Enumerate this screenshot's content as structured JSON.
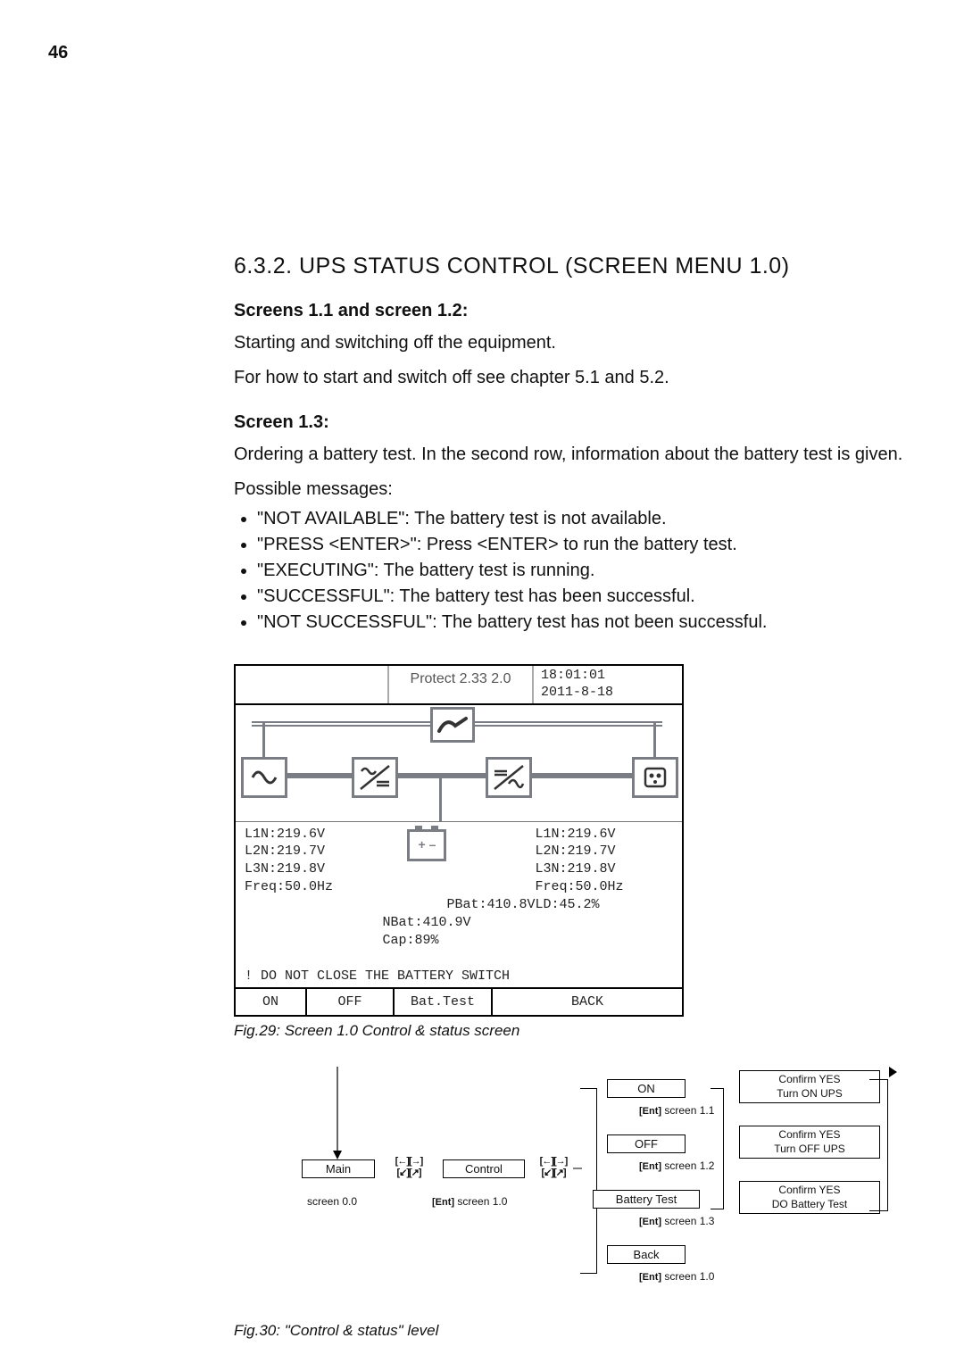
{
  "page_number": "46",
  "section_title": "6.3.2. UPS STATUS CONTROL (SCREEN MENU 1.0)",
  "subhead1": "Screens 1.1 and screen 1.2:",
  "para1": "Starting and switching off the equipment.",
  "para2": "For how to start and switch off see chapter 5.1 and 5.2.",
  "subhead2": "Screen 1.3:",
  "para3": "Ordering a battery test. In the second row, information about the battery test is given.",
  "para4": "Possible messages:",
  "messages": [
    "\"NOT AVAILABLE\": The battery test is not available.",
    "\"PRESS <ENTER>\": Press <ENTER> to run the battery test.",
    "\"EXECUTING\": The battery test is running.",
    "\"SUCCESSFUL\": The battery test has been successful.",
    "\"NOT SUCCESSFUL\": The battery test has not been successful."
  ],
  "fig29": {
    "model": "Protect 2.33 2.0",
    "time": "18:01:01",
    "date": "2011-8-18",
    "left_col": "L1N:219.6V\nL2N:219.7V\nL3N:219.8V\nFreq:50.0Hz",
    "center_col": "PBat:410.8V\nNBat:410.9V\nCap:89%",
    "right_col": "L1N:219.6V\nL2N:219.7V\nL3N:219.8V\nFreq:50.0Hz\nLD:45.2%",
    "warning": "! DO NOT CLOSE THE BATTERY SWITCH",
    "menu": {
      "on": "ON",
      "off": "OFF",
      "bat": "Bat.Test",
      "back": "BACK"
    },
    "caption": "Fig.29:  Screen 1.0 Control & status screen"
  },
  "fig30": {
    "main": "Main",
    "main_sub": "screen 0.0",
    "control": "Control",
    "control_sub1": "[Ent]",
    "control_sub": "screen 1.0",
    "on": "ON",
    "on_sub": "screen 1.1",
    "off": "OFF",
    "off_sub": "screen 1.2",
    "bat": "Battery Test",
    "bat_sub": "screen 1.3",
    "back": "Back",
    "back_sub": "screen 1.0",
    "confirm_on": "Confirm YES\nTurn ON UPS",
    "confirm_off": "Confirm YES\nTurn OFF UPS",
    "confirm_bat": "Confirm YES\nDO Battery Test",
    "ent": "[Ent]",
    "arrows": "[←][→]\n[↙][↗]",
    "caption": "Fig.30:  \"Control & status\" level"
  }
}
